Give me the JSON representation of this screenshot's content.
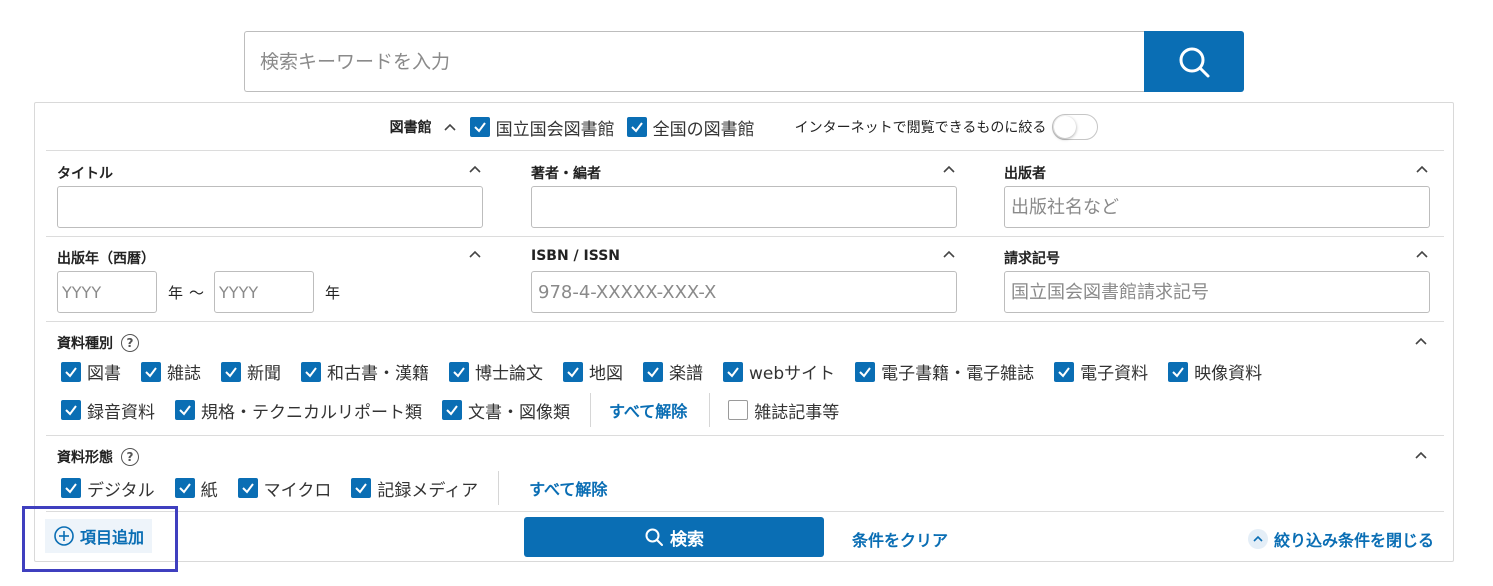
{
  "search": {
    "placeholder": "検索キーワードを入力",
    "button_icon": "search-icon"
  },
  "library": {
    "label": "図書館",
    "options": [
      {
        "label": "国立国会図書館",
        "checked": true
      },
      {
        "label": "全国の図書館",
        "checked": true
      }
    ],
    "internet_toggle_label": "インターネットで閲覧できるものに絞る",
    "internet_toggle_on": false
  },
  "fields": {
    "title": {
      "label": "タイトル",
      "placeholder": ""
    },
    "author": {
      "label": "著者・編者",
      "placeholder": ""
    },
    "publisher": {
      "label": "出版者",
      "placeholder": "出版社名など"
    },
    "pub_year": {
      "label": "出版年（西暦）",
      "from_placeholder": "YYYY",
      "to_placeholder": "YYYY",
      "unit": "年",
      "tilde": "〜"
    },
    "isbn": {
      "label": "ISBN / ISSN",
      "placeholder": "978-4-XXXXX-XXX-X"
    },
    "call_number": {
      "label": "請求記号",
      "placeholder": "国立国会図書館請求記号"
    }
  },
  "material_type": {
    "label": "資料種別",
    "row1": [
      "図書",
      "雑誌",
      "新聞",
      "和古書・漢籍",
      "博士論文",
      "地図",
      "楽譜",
      "webサイト",
      "電子書籍・電子雑誌",
      "電子資料",
      "映像資料"
    ],
    "row2": [
      "録音資料",
      "規格・テクニカルリポート類",
      "文書・図像類"
    ],
    "clear_all": "すべて解除",
    "article": {
      "label": "雑誌記事等",
      "checked": false
    }
  },
  "material_form": {
    "label": "資料形態",
    "items": [
      "デジタル",
      "紙",
      "マイクロ",
      "記録メディア"
    ],
    "clear_all": "すべて解除"
  },
  "footer": {
    "add_item": "項目追加",
    "search": "検索",
    "clear": "条件をクリア",
    "close": "絞り込み条件を閉じる"
  },
  "colors": {
    "accent": "#0a6eb4",
    "highlight": "#3f3fbf"
  }
}
